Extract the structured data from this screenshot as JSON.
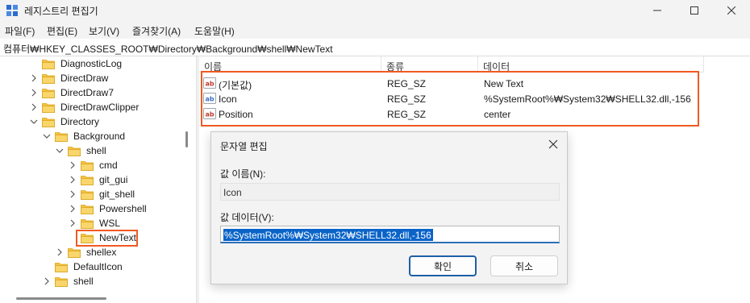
{
  "window": {
    "title": "레지스트리 편집기"
  },
  "menu": [
    "파일(F)",
    "편집(E)",
    "보기(V)",
    "즐겨찾기(A)",
    "도움말(H)"
  ],
  "address": "컴퓨터₩HKEY_CLASSES_ROOT₩Directory₩Background₩shell₩NewText",
  "tree": [
    {
      "label": "DiagnosticLog",
      "level": 2,
      "chevron": "none"
    },
    {
      "label": "DirectDraw",
      "level": 2,
      "chevron": "right"
    },
    {
      "label": "DirectDraw7",
      "level": 2,
      "chevron": "right"
    },
    {
      "label": "DirectDrawClipper",
      "level": 2,
      "chevron": "right"
    },
    {
      "label": "Directory",
      "level": 2,
      "chevron": "down"
    },
    {
      "label": "Background",
      "level": 3,
      "chevron": "down"
    },
    {
      "label": "shell",
      "level": 4,
      "chevron": "down"
    },
    {
      "label": "cmd",
      "level": 5,
      "chevron": "right"
    },
    {
      "label": "git_gui",
      "level": 5,
      "chevron": "right"
    },
    {
      "label": "git_shell",
      "level": 5,
      "chevron": "right"
    },
    {
      "label": "Powershell",
      "level": 5,
      "chevron": "right"
    },
    {
      "label": "WSL",
      "level": 5,
      "chevron": "right"
    },
    {
      "label": "NewText",
      "level": 5,
      "chevron": "none",
      "selected": true
    },
    {
      "label": "shellex",
      "level": 4,
      "chevron": "right"
    },
    {
      "label": "DefaultIcon",
      "level": 3,
      "chevron": "none"
    },
    {
      "label": "shell",
      "level": 3,
      "chevron": "right"
    }
  ],
  "columns": {
    "name": "이름",
    "type": "종류",
    "data": "데이터"
  },
  "values": [
    {
      "name": "(기본값)",
      "type": "REG_SZ",
      "data": "New Text",
      "icon": "string-value-icon"
    },
    {
      "name": "Icon",
      "type": "REG_SZ",
      "data": "%SystemRoot%₩System32₩SHELL32.dll,-156",
      "icon": "expand-string-value-icon"
    },
    {
      "name": "Position",
      "type": "REG_SZ",
      "data": "center",
      "icon": "string-value-icon"
    }
  ],
  "dialog": {
    "title": "문자열 편집",
    "name_label": "값 이름(N):",
    "name_value": "Icon",
    "data_label": "값 데이터(V):",
    "data_value": "%SystemRoot%₩System32₩SHELL32.dll,-156",
    "ok_label": "확인",
    "cancel_label": "취소"
  },
  "colors": {
    "highlight": "#f15a22",
    "selection": "#0a64c8",
    "folder": "#f6c342"
  }
}
